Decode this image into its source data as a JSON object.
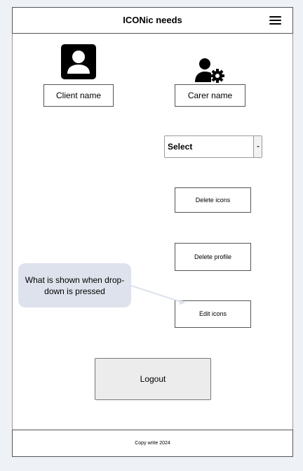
{
  "header": {
    "title": "ICONic needs",
    "menu_icon": "hamburger-menu-icon"
  },
  "profiles": {
    "client": {
      "icon": "user-profile-icon",
      "name_label": "Client name"
    },
    "carer": {
      "icon": "user-settings-icon",
      "name_label": "Carer name"
    }
  },
  "dropdown": {
    "selected": "Select",
    "icon": "chevron-down-icon"
  },
  "actions": {
    "delete_icons": "Delete icons",
    "delete_profile": "Delete profile",
    "edit_icons": "Edit icons"
  },
  "callout": {
    "text": "What is shown when drop-down is pressed"
  },
  "logout_label": "Logout",
  "footer": {
    "text": "Copy write 2024"
  },
  "colors": {
    "page_background": "#eef1f6",
    "callout_background": "#dde2ec",
    "logout_background": "#ececec",
    "border": "#555555"
  }
}
